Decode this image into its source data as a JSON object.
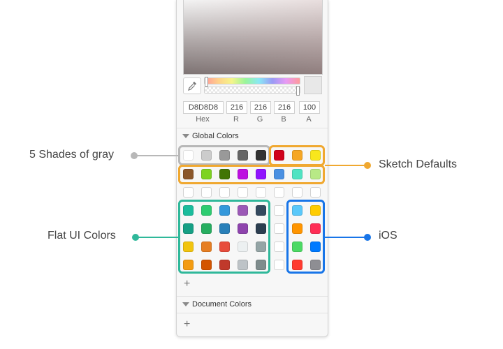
{
  "hex_value": "D8D8D8",
  "r_value": "216",
  "g_value": "216",
  "b_value": "216",
  "a_value": "100",
  "labels": {
    "hex": "Hex",
    "r": "R",
    "g": "G",
    "b": "B",
    "a": "A"
  },
  "global_colors": {
    "title": "Global Colors"
  },
  "document_colors": {
    "title": "Document Colors"
  },
  "callouts": {
    "gray": "5 Shades of gray",
    "sketch": "Sketch Defaults",
    "flat": "Flat UI Colors",
    "ios": "iOS"
  },
  "callout_colors": {
    "gray": "#b8b8b8",
    "sketch": "#f0a830",
    "flat": "#2fb89a",
    "ios": "#1875e8"
  },
  "swatches": {
    "gray_row": [
      "#ffffff",
      "#cccccc",
      "#999999",
      "#666666",
      "#333333"
    ],
    "sketch_row1": [
      "#d0021b",
      "#f5a623",
      "#f8e71c"
    ],
    "sketch_row2": [
      "#8b572a",
      "#7ed321",
      "#417505",
      "#bd10e0",
      "#9013fe",
      "#4a90e2",
      "#50e3c2",
      "#b8e986"
    ],
    "flat": [
      [
        "#1abc9c",
        "#2ecc71",
        "#3498db",
        "#9b59b6",
        "#34495e"
      ],
      [
        "#16a085",
        "#27ae60",
        "#2980b9",
        "#8e44ad",
        "#2c3e50"
      ],
      [
        "#f1c40f",
        "#e67e22",
        "#e74c3c",
        "#ecf0f1",
        "#95a5a6"
      ],
      [
        "#f39c12",
        "#d35400",
        "#c0392b",
        "#bdc3c7",
        "#7f8c8d"
      ]
    ],
    "ios": [
      [
        "#5ac8fa",
        "#ffcc00"
      ],
      [
        "#ff9500",
        "#ff2d55"
      ],
      [
        "#4cd964",
        "#007aff"
      ],
      [
        "#ff3b30",
        "#8e8e93"
      ]
    ]
  }
}
